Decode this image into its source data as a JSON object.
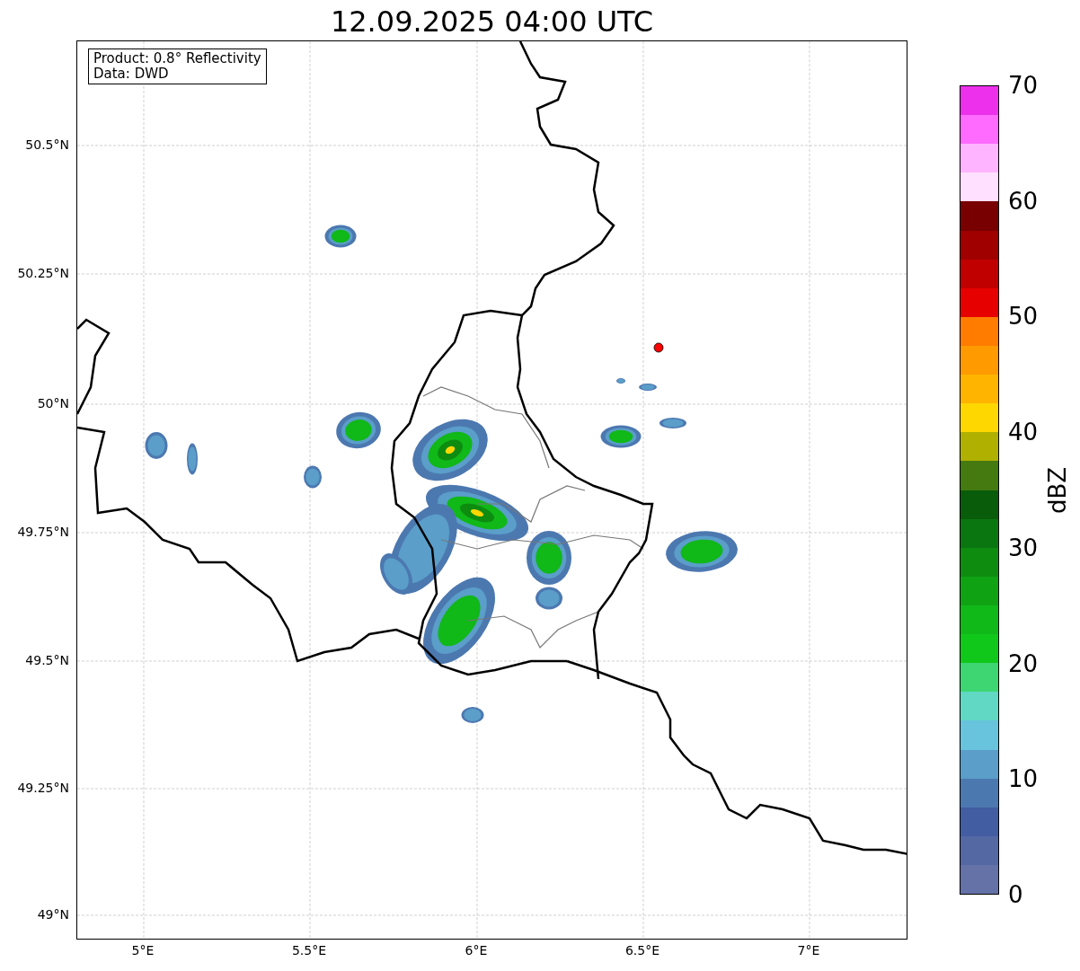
{
  "title": "12.09.2025 04:00 UTC",
  "map": {
    "info_box": [
      "Product: 0.8° Reflectivity",
      "Data: DWD"
    ],
    "x_ticks": [
      "5°E",
      "5.5°E",
      "6°E",
      "6.5°E",
      "7°E"
    ],
    "y_ticks": [
      "50.5°N",
      "50.25°N",
      "50°N",
      "49.75°N",
      "49.5°N",
      "49.25°N",
      "49°N"
    ]
  },
  "colorbar": {
    "label": "dBZ",
    "ticks": [
      "70",
      "60",
      "50",
      "40",
      "30",
      "20",
      "10",
      "0"
    ],
    "bands": [
      {
        "color": "#ec30ec"
      },
      {
        "color": "#ff6aff"
      },
      {
        "color": "#ffb4ff"
      },
      {
        "color": "#ffe0ff"
      },
      {
        "color": "#780000"
      },
      {
        "color": "#a00000"
      },
      {
        "color": "#c00000"
      },
      {
        "color": "#e60000"
      },
      {
        "color": "#ff7c00"
      },
      {
        "color": "#ff9a00"
      },
      {
        "color": "#ffb400"
      },
      {
        "color": "#ffd700"
      },
      {
        "color": "#b0b000"
      },
      {
        "color": "#457a10"
      },
      {
        "color": "#085c0a"
      },
      {
        "color": "#0a7610"
      },
      {
        "color": "#0d8c10"
      },
      {
        "color": "#0fa314"
      },
      {
        "color": "#10b818"
      },
      {
        "color": "#10c81a"
      },
      {
        "color": "#3dd672"
      },
      {
        "color": "#60d8c4"
      },
      {
        "color": "#68c3dc"
      },
      {
        "color": "#5a9ec9"
      },
      {
        "color": "#4c78b0"
      },
      {
        "color": "#425da2"
      },
      {
        "color": "#5468a4"
      },
      {
        "color": "#6572a8"
      }
    ]
  }
}
